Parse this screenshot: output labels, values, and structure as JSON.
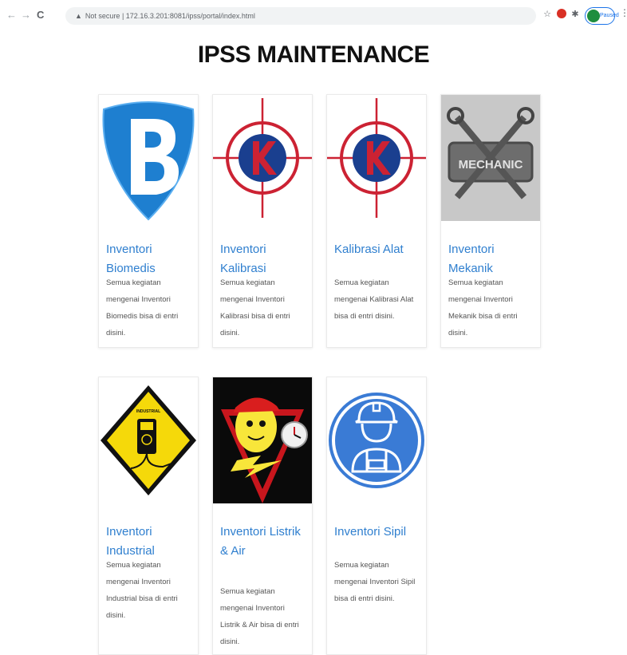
{
  "browser": {
    "back": "←",
    "forward": "→",
    "reload": "C",
    "security": "Not secure",
    "url": "172.16.3.201:8081/ipss/portal/index.html",
    "profile_label": "Paused"
  },
  "page": {
    "title": "IPSS MAINTENANCE"
  },
  "cards": [
    {
      "title": "Inventori Biomedis",
      "desc": "Semua kegiatan mengenai Inventori Biomedis bisa di entri disini."
    },
    {
      "title": "Inventori Kalibrasi",
      "desc": "Semua kegiatan mengenai Inventori Kalibrasi bisa di entri disini."
    },
    {
      "title": "Kalibrasi Alat",
      "desc": "Semua kegiatan mengenai Kalibrasi Alat bisa di entri disini."
    },
    {
      "title": "Inventori Mekanik",
      "desc": "Semua kegiatan mengenai Inventori Mekanik bisa di entri disini."
    },
    {
      "title": "Inventori Industrial",
      "desc": "Semua kegiatan mengenai Inventori Industrial bisa di entri disini."
    },
    {
      "title": "Inventori Listrik & Air",
      "desc": "Semua kegiatan mengenai Inventori Listrik & Air bisa di entri disini."
    },
    {
      "title": "Inventori Sipil",
      "desc": "Semua kegiatan mengenai Inventori Sipil bisa di entri disini."
    }
  ],
  "image_badges": {
    "mechanic": "MECHANIC",
    "industrial": "INDUSTRIAL"
  },
  "colors": {
    "link": "#2f7fcf",
    "biomedis": "#1e7fd0",
    "kalibrasi_red": "#cc2233",
    "kalibrasi_blue": "#1a3f8f",
    "sipil": "#3a7bd5"
  }
}
